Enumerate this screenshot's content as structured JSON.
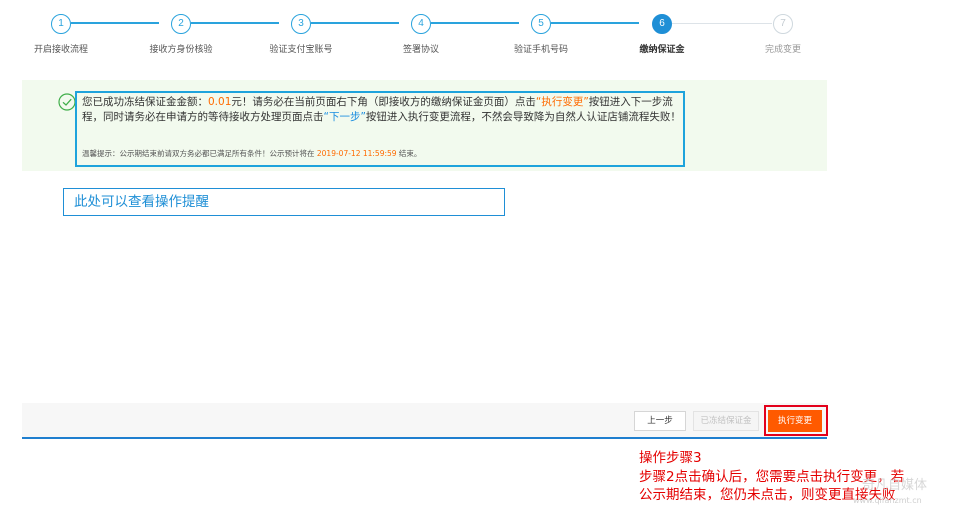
{
  "steps": [
    {
      "num": "1",
      "label": "开启接收流程",
      "state": "done"
    },
    {
      "num": "2",
      "label": "接收方身份核验",
      "state": "done"
    },
    {
      "num": "3",
      "label": "验证支付宝账号",
      "state": "done"
    },
    {
      "num": "4",
      "label": "签署协议",
      "state": "done"
    },
    {
      "num": "5",
      "label": "验证手机号码",
      "state": "done"
    },
    {
      "num": "6",
      "label": "缴纳保证金",
      "state": "active"
    },
    {
      "num": "7",
      "label": "完成变更",
      "state": "future"
    }
  ],
  "notice": {
    "p1": "您已成功冻结保证金金额：",
    "amount": "0.01",
    "p2": "元！请务必在当前页面右下角（即接收方的缴纳保证金页面）点击",
    "hl1": "“执行变更”",
    "p3": "按钮进入下一步流程，同时请务必在申请方的等待接收方处理页面点击",
    "hl2": "“下一步”",
    "p4": "按钮进入执行变更流程，不然会导致降为自然人认证店铺流程失败！",
    "tip_prefix": "温馨提示：公示期结束前请双方务必都已满足所有条件！公示预计将在 ",
    "tip_time": "2019-07-12 11:59:59",
    "tip_suffix": " 结束。"
  },
  "annotation": "此处可以查看操作提醒",
  "buttons": {
    "prev": "上一步",
    "frozen": "已冻结保证金",
    "execute": "执行变更"
  },
  "note": {
    "line1": "操作步骤3",
    "line2": "步骤2点击确认后，您需要点击执行变更，若",
    "line3": "公示期结束，您仍未点击，则变更直接失败"
  },
  "watermark": {
    "logo": "奇凡自媒体",
    "url": "www.qifanzmt.cn"
  },
  "colors": {
    "accent": "#1f8fd6",
    "highlight": "#ff6a00",
    "execute_button": "#ff5a00",
    "annotation_red": "#e40000",
    "notice_bg": "#f2faee"
  }
}
